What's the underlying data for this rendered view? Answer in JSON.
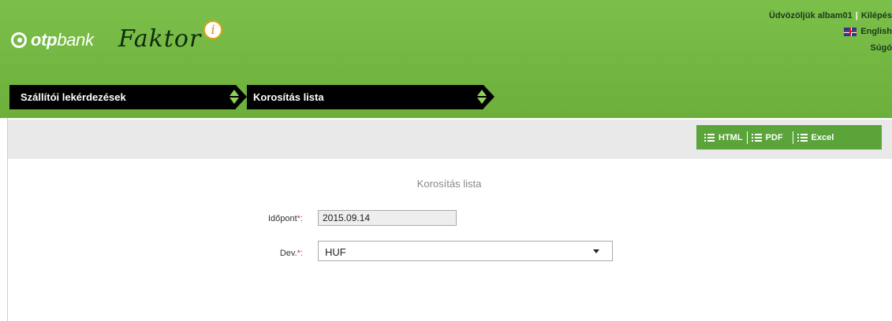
{
  "header": {
    "bank_logo_text_bold": "otp",
    "bank_logo_text_rest": "bank",
    "app_title": "Faktor",
    "app_title_badge": "i",
    "welcome": "Üdvözöljük albam01",
    "logout": "Kilépés",
    "language": "English",
    "help": "Súgó"
  },
  "breadcrumb": {
    "items": [
      {
        "label": "Szállítói lekérdezések"
      },
      {
        "label": "Korosítás lista"
      }
    ]
  },
  "export": {
    "html_label": "HTML",
    "pdf_label": "PDF",
    "excel_label": "Excel"
  },
  "form": {
    "title": "Korosítás lista",
    "date_label": "Időpont",
    "date_required": "*:",
    "date_value": "2015.09.14",
    "currency_label": "Dev.",
    "currency_required": "*:",
    "currency_value": "HUF"
  },
  "colors": {
    "header_green": "#74b843",
    "export_green": "#5aa43a",
    "breadcrumb_black": "#000000"
  }
}
